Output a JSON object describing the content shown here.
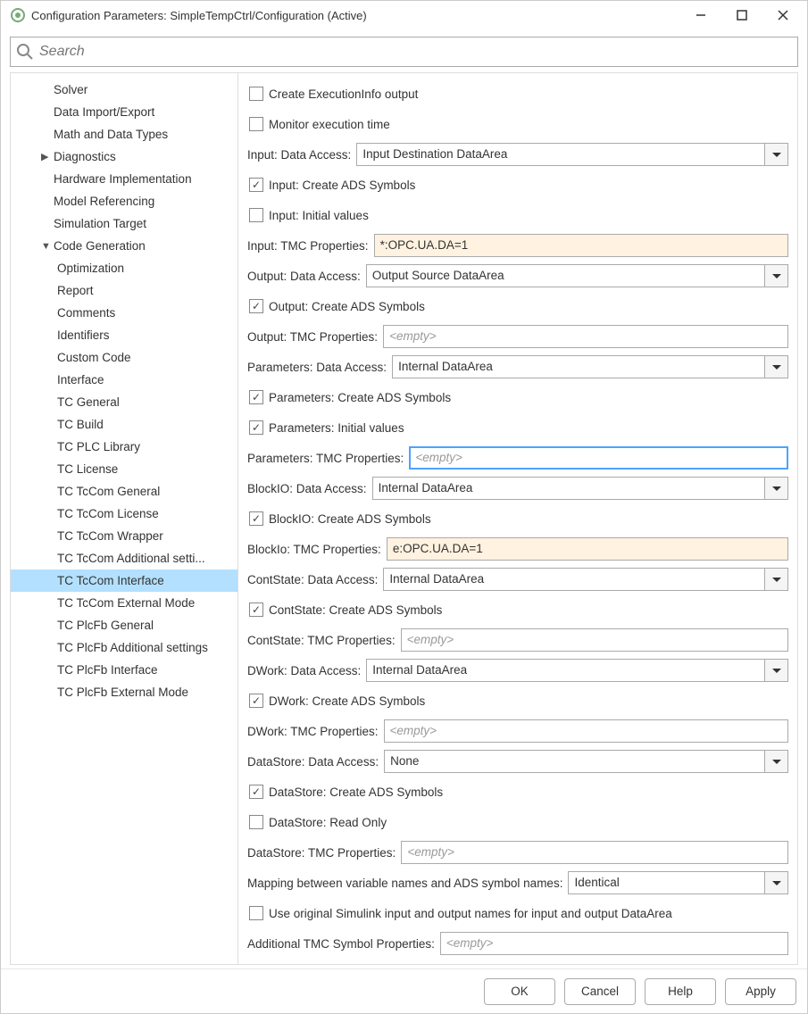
{
  "window": {
    "title": "Configuration Parameters: SimpleTempCtrl/Configuration (Active)"
  },
  "search": {
    "placeholder": "Search"
  },
  "tree": {
    "items": [
      {
        "label": "Solver",
        "depth": 1,
        "arrow": ""
      },
      {
        "label": "Data Import/Export",
        "depth": 1,
        "arrow": ""
      },
      {
        "label": "Math and Data Types",
        "depth": 1,
        "arrow": ""
      },
      {
        "label": "Diagnostics",
        "depth": 1,
        "arrow": "▶"
      },
      {
        "label": "Hardware Implementation",
        "depth": 1,
        "arrow": ""
      },
      {
        "label": "Model Referencing",
        "depth": 1,
        "arrow": ""
      },
      {
        "label": "Simulation Target",
        "depth": 1,
        "arrow": ""
      },
      {
        "label": "Code Generation",
        "depth": 1,
        "arrow": "▼"
      },
      {
        "label": "Optimization",
        "depth": 2,
        "arrow": ""
      },
      {
        "label": "Report",
        "depth": 2,
        "arrow": ""
      },
      {
        "label": "Comments",
        "depth": 2,
        "arrow": ""
      },
      {
        "label": "Identifiers",
        "depth": 2,
        "arrow": ""
      },
      {
        "label": "Custom Code",
        "depth": 2,
        "arrow": ""
      },
      {
        "label": "Interface",
        "depth": 2,
        "arrow": ""
      },
      {
        "label": "TC General",
        "depth": 2,
        "arrow": ""
      },
      {
        "label": "TC Build",
        "depth": 2,
        "arrow": ""
      },
      {
        "label": "TC PLC Library",
        "depth": 2,
        "arrow": ""
      },
      {
        "label": "TC License",
        "depth": 2,
        "arrow": ""
      },
      {
        "label": "TC TcCom General",
        "depth": 2,
        "arrow": ""
      },
      {
        "label": "TC TcCom License",
        "depth": 2,
        "arrow": ""
      },
      {
        "label": "TC TcCom Wrapper",
        "depth": 2,
        "arrow": ""
      },
      {
        "label": "TC TcCom Additional setti...",
        "depth": 2,
        "arrow": ""
      },
      {
        "label": "TC TcCom Interface",
        "depth": 2,
        "arrow": "",
        "selected": true
      },
      {
        "label": "TC TcCom External Mode",
        "depth": 2,
        "arrow": ""
      },
      {
        "label": "TC PlcFb General",
        "depth": 2,
        "arrow": ""
      },
      {
        "label": "TC PlcFb Additional settings",
        "depth": 2,
        "arrow": ""
      },
      {
        "label": "TC PlcFb Interface",
        "depth": 2,
        "arrow": ""
      },
      {
        "label": "TC PlcFb External Mode",
        "depth": 2,
        "arrow": ""
      }
    ]
  },
  "form": {
    "create_execinfo": {
      "label": "Create ExecutionInfo output",
      "checked": false
    },
    "monitor_exec": {
      "label": "Monitor execution time",
      "checked": false
    },
    "input_da": {
      "label": "Input: Data Access:",
      "value": "Input Destination DataArea"
    },
    "input_ads": {
      "label": "Input: Create ADS Symbols",
      "checked": true
    },
    "input_init": {
      "label": "Input: Initial values",
      "checked": false
    },
    "input_tmc": {
      "label": "Input: TMC Properties:",
      "value": "*:OPC.UA.DA=1"
    },
    "output_da": {
      "label": "Output: Data Access:",
      "value": "Output Source DataArea"
    },
    "output_ads": {
      "label": "Output: Create ADS Symbols",
      "checked": true
    },
    "output_tmc": {
      "label": "Output: TMC Properties:",
      "placeholder": "<empty>"
    },
    "params_da": {
      "label": "Parameters: Data Access:",
      "value": "Internal DataArea"
    },
    "params_ads": {
      "label": "Parameters: Create ADS Symbols",
      "checked": true
    },
    "params_init": {
      "label": "Parameters: Initial values",
      "checked": true
    },
    "params_tmc": {
      "label": "Parameters: TMC Properties:",
      "placeholder": "<empty>",
      "focused": true
    },
    "blockio_da": {
      "label": "BlockIO: Data Access:",
      "value": "Internal DataArea"
    },
    "blockio_ads": {
      "label": "BlockIO: Create ADS Symbols",
      "checked": true
    },
    "blockio_tmc": {
      "label": "BlockIo: TMC Properties:",
      "value": "e:OPC.UA.DA=1"
    },
    "contstate_da": {
      "label": "ContState: Data Access:",
      "value": "Internal DataArea"
    },
    "contstate_ads": {
      "label": "ContState: Create ADS Symbols",
      "checked": true
    },
    "contstate_tmc": {
      "label": "ContState: TMC Properties:",
      "placeholder": "<empty>"
    },
    "dwork_da": {
      "label": "DWork: Data Access:",
      "value": "Internal DataArea"
    },
    "dwork_ads": {
      "label": "DWork: Create ADS Symbols",
      "checked": true
    },
    "dwork_tmc": {
      "label": "DWork: TMC Properties:",
      "placeholder": "<empty>"
    },
    "datastore_da": {
      "label": "DataStore: Data Access:",
      "value": "None"
    },
    "datastore_ads": {
      "label": "DataStore: Create ADS Symbols",
      "checked": true
    },
    "datastore_ro": {
      "label": "DataStore: Read Only",
      "checked": false
    },
    "datastore_tmc": {
      "label": "DataStore: TMC Properties:",
      "placeholder": "<empty>"
    },
    "mapping": {
      "label": "Mapping between variable names and ADS symbol names:",
      "value": "Identical"
    },
    "use_orig": {
      "label": "Use original Simulink input and output names for input and output DataArea",
      "checked": false
    },
    "addl_tmc": {
      "label": "Additional TMC Symbol Properties:",
      "placeholder": "<empty>"
    }
  },
  "footer": {
    "ok": "OK",
    "cancel": "Cancel",
    "help": "Help",
    "apply": "Apply"
  }
}
